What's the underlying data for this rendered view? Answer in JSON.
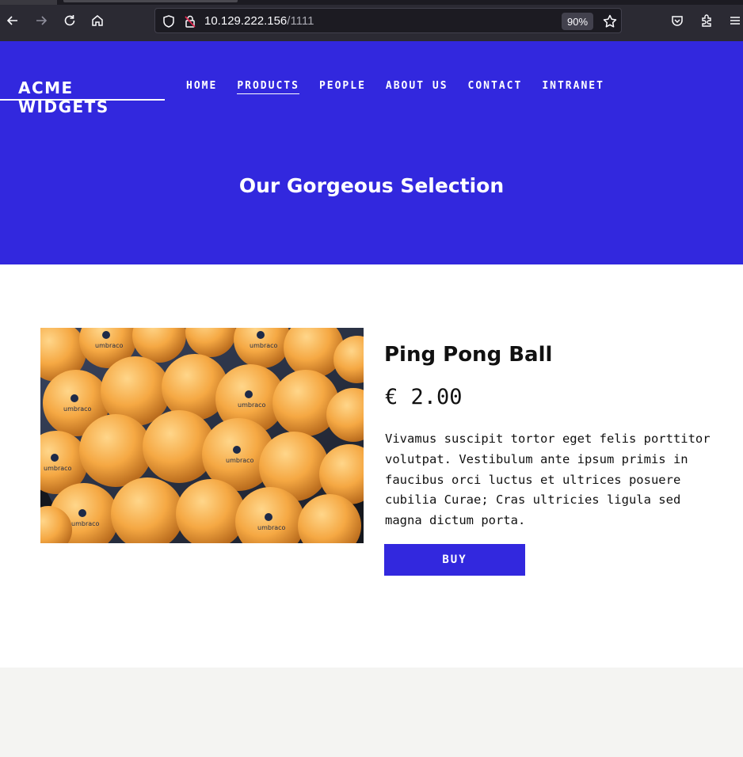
{
  "browser": {
    "url_host": "10.129.222.156",
    "url_path": "/1111",
    "zoom": "90%"
  },
  "site": {
    "logo": "ACME WIDGETS",
    "nav": [
      {
        "label": "HOME"
      },
      {
        "label": "PRODUCTS",
        "active": true
      },
      {
        "label": "PEOPLE"
      },
      {
        "label": "ABOUT US"
      },
      {
        "label": "CONTACT"
      },
      {
        "label": "INTRANET"
      }
    ],
    "hero_title": "Our Gorgeous Selection"
  },
  "product": {
    "name": "Ping Pong Ball",
    "price": "€ 2.00",
    "description": "Vivamus suscipit tortor eget felis porttitor volutpat. Vestibulum ante ipsum primis in faucibus orci luctus et ultrices posuere cubilia Curae; Cras ultricies ligula sed magna dictum porta.",
    "buy_label": "BUY",
    "ball_text": "umbraco"
  },
  "colors": {
    "brand": "#3228de",
    "chrome": "#2b2a33",
    "ball": "#f5a843"
  }
}
